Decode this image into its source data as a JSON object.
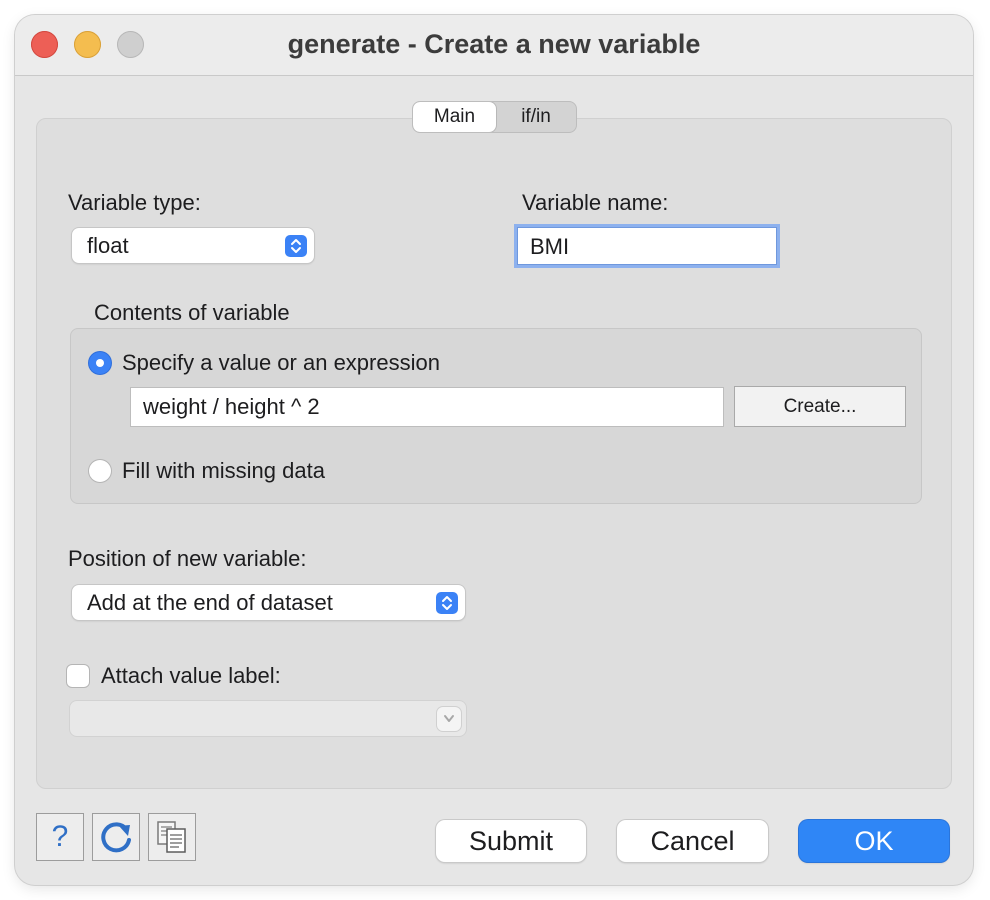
{
  "window": {
    "title": "generate - Create a new variable",
    "controls": [
      "close",
      "minimize",
      "zoom"
    ],
    "colors": {
      "close": "#ed5f56",
      "minimize": "#f4bd4f",
      "zoom": "#cfcfcf",
      "accent": "#3b82f6"
    }
  },
  "tabs": [
    {
      "label": "Main",
      "active": true
    },
    {
      "label": "if/in",
      "active": false
    }
  ],
  "form": {
    "variable_type_label": "Variable type:",
    "variable_type_value": "float",
    "variable_name_label": "Variable name:",
    "variable_name_value": "BMI",
    "contents_label": "Contents of variable",
    "option_expression_label": "Specify a value or an expression",
    "option_expression_selected": true,
    "expression_value": "weight / height ^ 2",
    "create_button_label": "Create...",
    "option_missing_label": "Fill with missing data",
    "option_missing_selected": false,
    "position_label": "Position of new variable:",
    "position_value": "Add at the end of dataset",
    "attach_label": "Attach value label:",
    "attach_checked": false,
    "value_label_select_value": ""
  },
  "footer": {
    "tool_icons": [
      "help-icon",
      "reset-icon",
      "copy-command-icon"
    ],
    "help_glyph": "?",
    "submit_label": "Submit",
    "cancel_label": "Cancel",
    "ok_label": "OK"
  }
}
